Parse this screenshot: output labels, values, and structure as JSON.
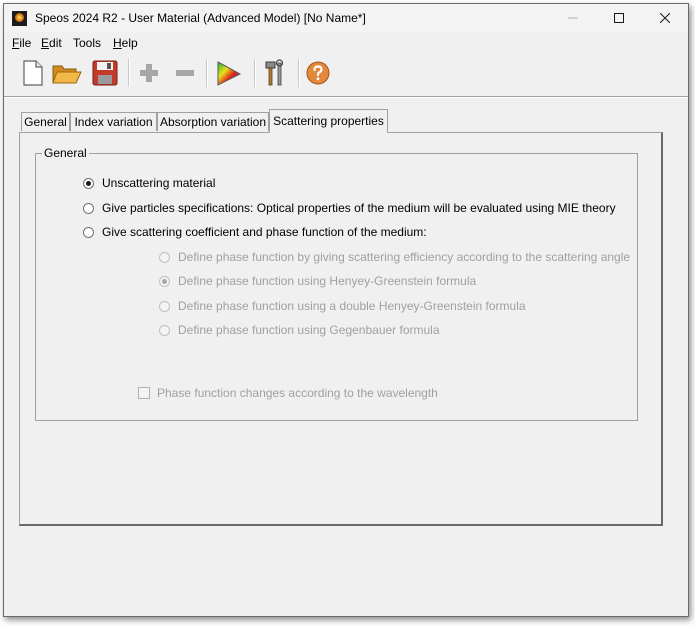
{
  "window": {
    "title": "Speos 2024 R2 - User Material (Advanced Model) [No Name*]"
  },
  "menu": [
    {
      "label": "File",
      "accel": "F",
      "rest": "ile"
    },
    {
      "label": "Edit",
      "accel": "E",
      "rest": "dit"
    },
    {
      "label": "Tools",
      "accel": "",
      "rest": "Tools"
    },
    {
      "label": "Help",
      "accel": "H",
      "rest": "elp"
    }
  ],
  "toolbar": [
    "new-file-icon",
    "open-folder-icon",
    "save-icon",
    "add-icon",
    "remove-icon",
    "color-spectrum-icon",
    "tools-icon",
    "help-icon"
  ],
  "tabs": [
    {
      "label": "General",
      "active": false
    },
    {
      "label": "Index variation",
      "active": false
    },
    {
      "label": "Absorption variation",
      "active": false
    },
    {
      "label": "Scattering properties",
      "active": true
    }
  ],
  "group": {
    "title": "General",
    "options": [
      {
        "label": "Unscattering material",
        "selected": true,
        "enabled": true
      },
      {
        "label": "Give particles specifications: Optical properties of the medium will be evaluated using MIE theory",
        "selected": false,
        "enabled": true
      },
      {
        "label": "Give scattering coefficient and phase function of the medium:",
        "selected": false,
        "enabled": true
      }
    ],
    "sub_options": [
      {
        "label": "Define phase function by giving scattering efficiency according to the scattering  angle",
        "selected": false,
        "enabled": false
      },
      {
        "label": "Define phase function using Henyey-Greenstein formula",
        "selected": true,
        "enabled": false
      },
      {
        "label": "Define phase function using a double Henyey-Greenstein formula",
        "selected": false,
        "enabled": false
      },
      {
        "label": "Define phase function using Gegenbauer formula",
        "selected": false,
        "enabled": false
      }
    ],
    "wavelength_checkbox": {
      "label": "Phase function changes according to the wavelength",
      "checked": false,
      "enabled": false
    }
  }
}
